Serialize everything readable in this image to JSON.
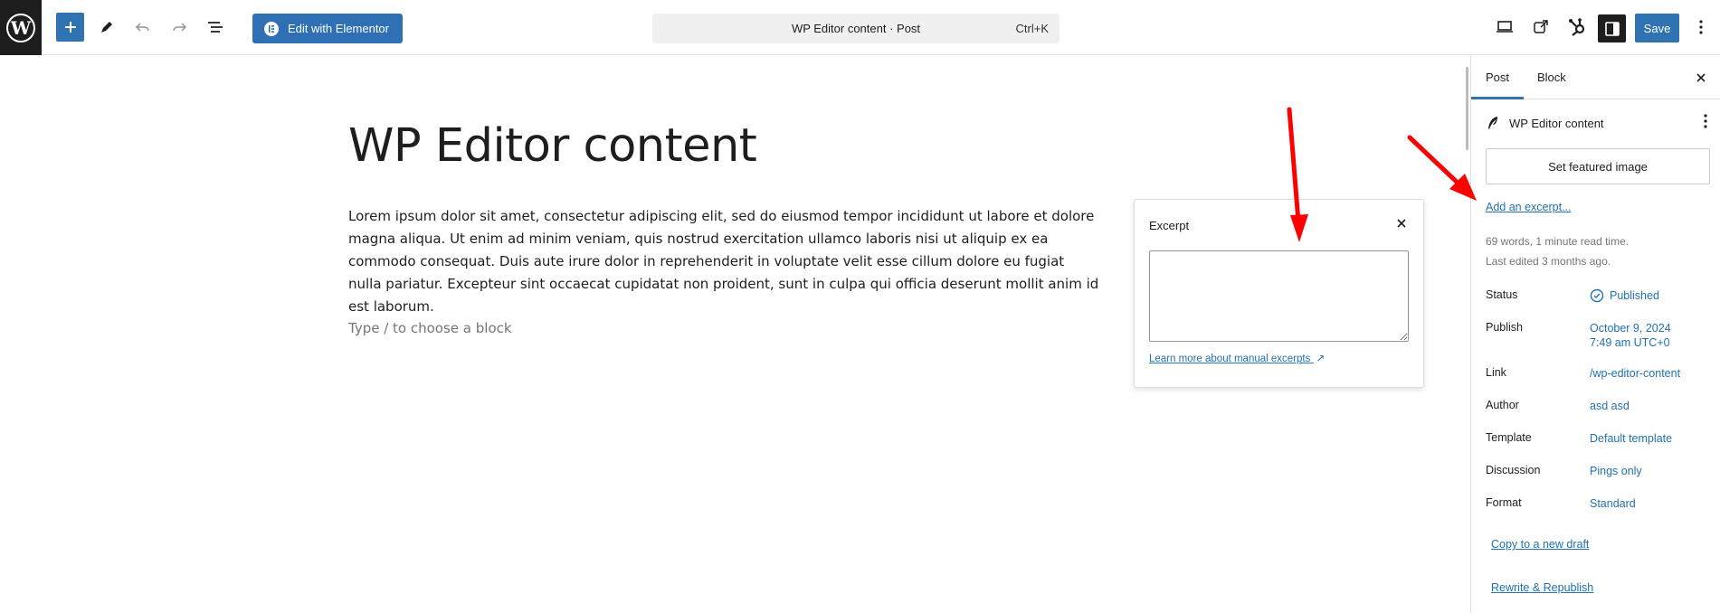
{
  "toolbar": {
    "elementor_label": "Edit with Elementor",
    "command_title": "WP Editor content · Post",
    "command_shortcut": "Ctrl+K",
    "save_label": "Save",
    "icons": [
      "wordpress-logo-icon",
      "plus-icon",
      "pencil-icon",
      "undo-icon",
      "redo-icon",
      "list-view-icon",
      "elementor-icon",
      "desktop-icon",
      "external-link-icon",
      "hubspot-icon",
      "settings-sidebar-icon",
      "more-vertical-icon"
    ]
  },
  "editor": {
    "title": "WP Editor content",
    "paragraph": "Lorem ipsum dolor sit amet, consectetur adipiscing elit, sed do eiusmod tempor incididunt ut labore et dolore magna aliqua. Ut enim ad minim veniam, quis nostrud exercitation ullamco laboris nisi ut aliquip ex ea commodo consequat. Duis aute irure dolor in reprehenderit in voluptate velit esse cillum dolore eu fugiat nulla pariatur. Excepteur sint occaecat cupidatat non proident, sunt in culpa qui officia deserunt mollit anim id est laborum.",
    "placeholder": "Type / to choose a block"
  },
  "excerpt_popover": {
    "title": "Excerpt",
    "value": "",
    "learn_more": "Learn more about manual excerpts",
    "learn_more_suffix": "↗"
  },
  "sidebar": {
    "tabs": [
      "Post",
      "Block"
    ],
    "post_title": "WP Editor content",
    "featured_image_label": "Set featured image",
    "add_excerpt_label": "Add an excerpt...",
    "stats": "69 words, 1 minute read time.",
    "last_edited": "Last edited 3 months ago.",
    "rows": [
      {
        "label": "Status",
        "value": "Published"
      },
      {
        "label": "Publish",
        "value": "October 9, 2024",
        "value2": "7:49 am UTC+0"
      },
      {
        "label": "Link",
        "value": "/wp-editor-content"
      },
      {
        "label": "Author",
        "value": "asd asd"
      },
      {
        "label": "Template",
        "value": "Default template"
      },
      {
        "label": "Discussion",
        "value": "Pings only"
      },
      {
        "label": "Format",
        "value": "Standard"
      }
    ],
    "copy_draft_label": "Copy to a new draft",
    "rewrite_label": "Rewrite & Republish"
  },
  "colors": {
    "accent": "#3073b3",
    "link": "#2271b1",
    "annotation_arrow": "#ff0000"
  }
}
